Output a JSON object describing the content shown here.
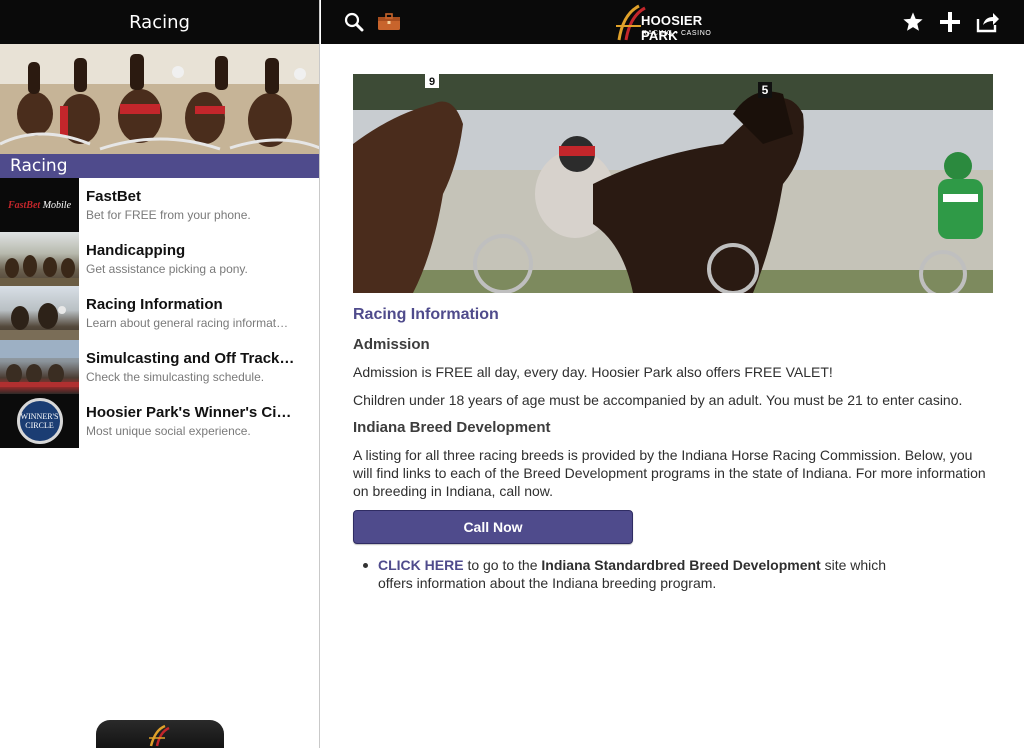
{
  "sidebar": {
    "header_title": "Racing",
    "section_title": "Racing",
    "items": [
      {
        "title": "FastBet",
        "subtitle": "Bet for FREE from your phone.",
        "thumb_brand": "FastBet",
        "thumb_brand_suffix": "Mobile"
      },
      {
        "title": "Handicapping",
        "subtitle": "Get assistance picking a pony."
      },
      {
        "title": "Racing Information",
        "subtitle": "Learn about general racing informat…"
      },
      {
        "title": "Simulcasting and Off Track…",
        "subtitle": "Check the simulcasting schedule."
      },
      {
        "title": "Hoosier Park's Winner's Ci…",
        "subtitle": "Most unique social experience.",
        "thumb_brand": "WINNER'S CIRCLE"
      }
    ]
  },
  "topbar": {
    "logo_title": "HOOSIER PARK",
    "logo_subtitle": "RACING • CASINO",
    "left_icons": [
      "search-icon",
      "briefcase-icon"
    ],
    "right_icons": [
      "star-icon",
      "plus-icon",
      "share-icon"
    ]
  },
  "main": {
    "heading": "Racing Information",
    "admission_heading": "Admission",
    "admission_p1": "Admission is FREE all day, every day. Hoosier Park also offers FREE VALET!",
    "admission_p2": "Children under 18 years of age must be accompanied by an adult. You must be 21 to enter casino.",
    "breed_heading": "Indiana Breed Development",
    "breed_p": "A listing for all three racing breeds is provided by the Indiana Horse Racing Commission. Below, you will find links to each of the Breed Development programs in the state of Indiana. For more information on breeding in Indiana, call now.",
    "call_button": "Call Now",
    "link_click_here": "CLICK HERE",
    "link_mid": " to go to the ",
    "link_bold": "Indiana Standardbred Breed Development",
    "link_tail": " site which offers information about the Indiana breeding program.",
    "hero_numbers": [
      "9",
      "5"
    ]
  },
  "colors": {
    "accent": "#4f4b8c",
    "bar": "#0a0a0a",
    "logo_red": "#c3262b",
    "logo_gold": "#e0a12a"
  }
}
